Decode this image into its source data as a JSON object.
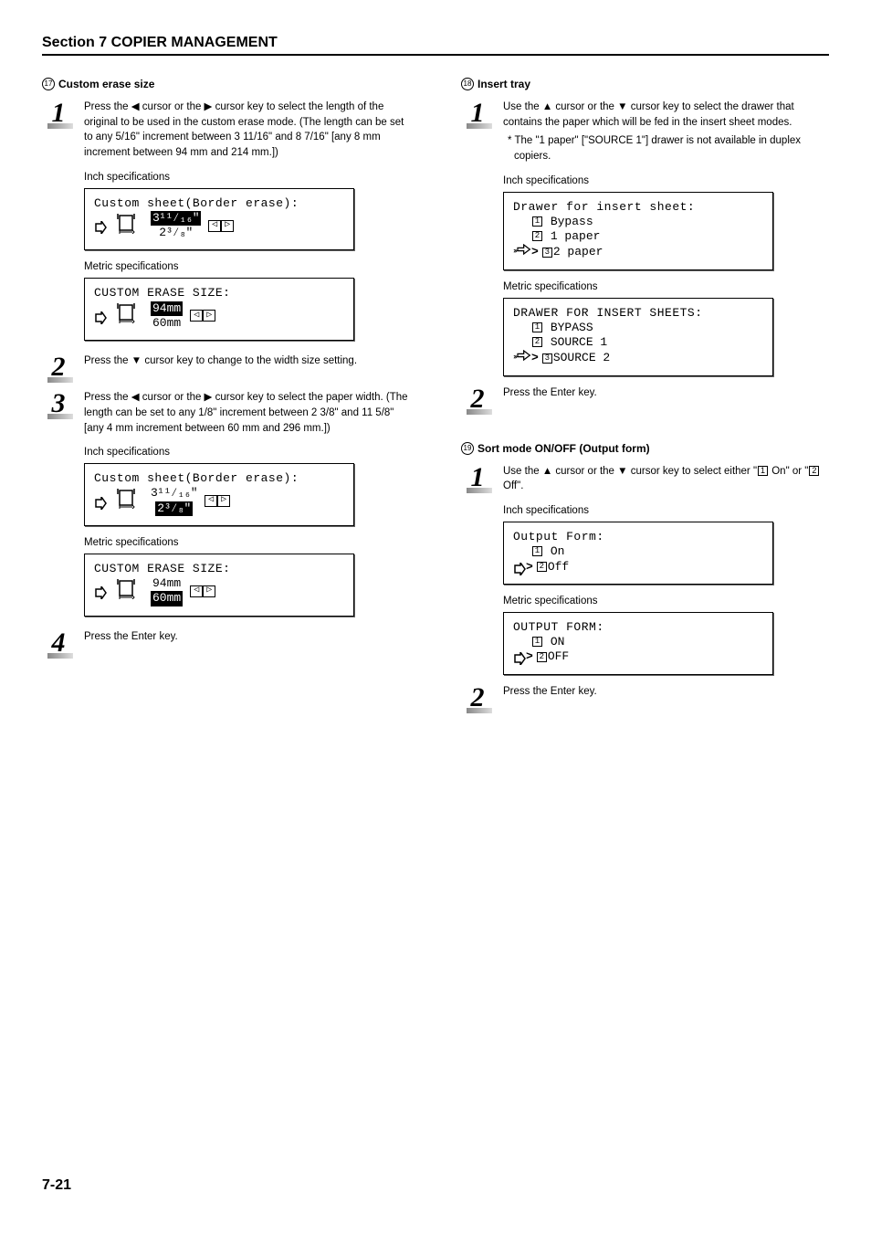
{
  "section_title": "Section 7  COPIER MANAGEMENT",
  "page_number": "7-21",
  "left": {
    "heading_num": "17",
    "heading": "Custom erase size",
    "steps": {
      "1": {
        "num": "1",
        "text": "Press the ◀ cursor or the ▶ cursor key to select the length of the original to be used in the custom erase mode. (The length can be set to any 5/16\" increment between 3 11/16\" and 8 7/16\" [any 8 mm increment between 94 mm and 214 mm.])"
      },
      "2": {
        "num": "2",
        "text": "Press the ▼ cursor key to change to the width size setting."
      },
      "3": {
        "num": "3",
        "text": "Press the ◀ cursor or the ▶ cursor key to select the paper width. (The length can be set to any 1/8\" increment between 2 3/8\" and 11 5/8\" [any 4 mm increment between 60 mm and 296 mm.])"
      },
      "4": {
        "num": "4",
        "text": "Press the Enter key."
      }
    },
    "labels": {
      "inch": "Inch specifications",
      "metric": "Metric specifications"
    },
    "lcd": {
      "inch1": {
        "title": "Custom sheet(Border erase):",
        "val1": "3¹¹⁄₁₆\"",
        "val2": "2³⁄₈\""
      },
      "metric1": {
        "title": "CUSTOM ERASE SIZE:",
        "val1": "94mm",
        "val2": "60mm"
      },
      "inch2": {
        "title": "Custom sheet(Border erase):",
        "val1": "3¹¹⁄₁₆\"",
        "val2": "2³⁄₈\""
      },
      "metric2": {
        "title": "CUSTOM ERASE SIZE:",
        "val1": "94mm",
        "val2": "60mm"
      }
    }
  },
  "right": {
    "h18_num": "18",
    "h18": "Insert tray",
    "steps18": {
      "1": {
        "num": "1",
        "text": "Use the ▲ cursor or the ▼ cursor key to select the drawer that contains the paper which will be fed in the insert sheet modes."
      },
      "note": "* The \"1 paper\" [\"SOURCE 1\"] drawer is not available in duplex copiers.",
      "2": {
        "num": "2",
        "text": "Press the Enter key."
      }
    },
    "labels": {
      "inch": "Inch specifications",
      "metric": "Metric specifications"
    },
    "lcd18": {
      "inch": {
        "title": "Drawer for insert sheet:",
        "o1": "Bypass",
        "o2": "1 paper",
        "o3": "2 paper"
      },
      "metric": {
        "title": "DRAWER FOR INSERT SHEETS:",
        "o1": "BYPASS",
        "o2": "SOURCE 1",
        "o3": "SOURCE 2"
      }
    },
    "h19_num": "19",
    "h19": "Sort mode ON/OFF (Output form)",
    "steps19": {
      "1": {
        "num": "1",
        "text_a": "Use the ▲ cursor or the ▼ cursor key to select either \"",
        "opt1": "1",
        "text_b": " On\" or \"",
        "opt2": "2",
        "text_c": " Off\"."
      },
      "2": {
        "num": "2",
        "text": "Press the Enter key."
      }
    },
    "lcd19": {
      "inch": {
        "title": "Output Form:",
        "o1": "On",
        "o2": "Off"
      },
      "metric": {
        "title": "OUTPUT FORM:",
        "o1": "ON",
        "o2": "OFF"
      }
    }
  }
}
